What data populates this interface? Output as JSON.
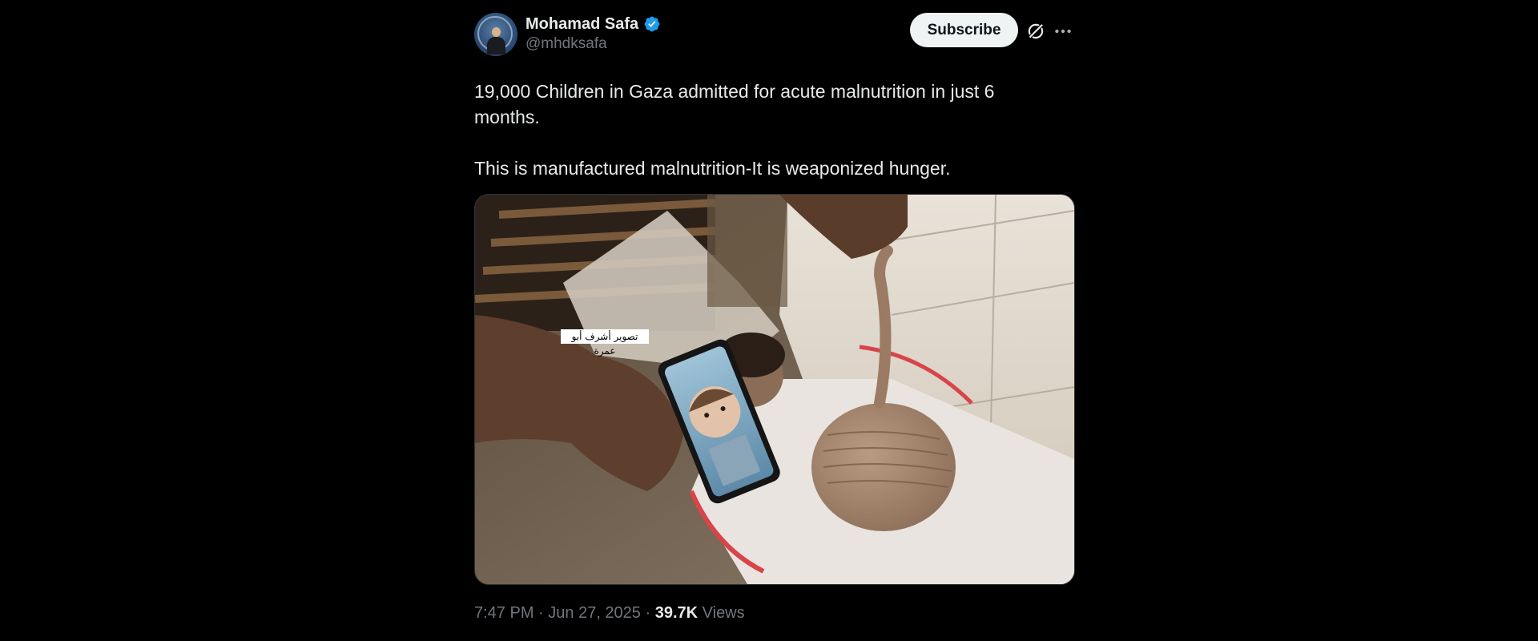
{
  "author": {
    "name": "Mohamad Safa",
    "handle": "@mhdksafa",
    "verified_color": "#1d9bf0"
  },
  "actions": {
    "subscribe_label": "Subscribe",
    "grok_icon": "grok-icon",
    "more_icon": "more-icon"
  },
  "post": {
    "text_line1": "19,000 Children in Gaza admitted for acute malnutrition in just 6 months.",
    "text_line2": "This is manufactured malnutrition-It is weaponized hunger."
  },
  "media": {
    "caption_overlay": "تصوير أشرف أبو عمرة"
  },
  "meta": {
    "time": "7:47 PM",
    "separator": " · ",
    "date": "Jun 27, 2025",
    "views_count": "39.7K",
    "views_label": "Views"
  }
}
